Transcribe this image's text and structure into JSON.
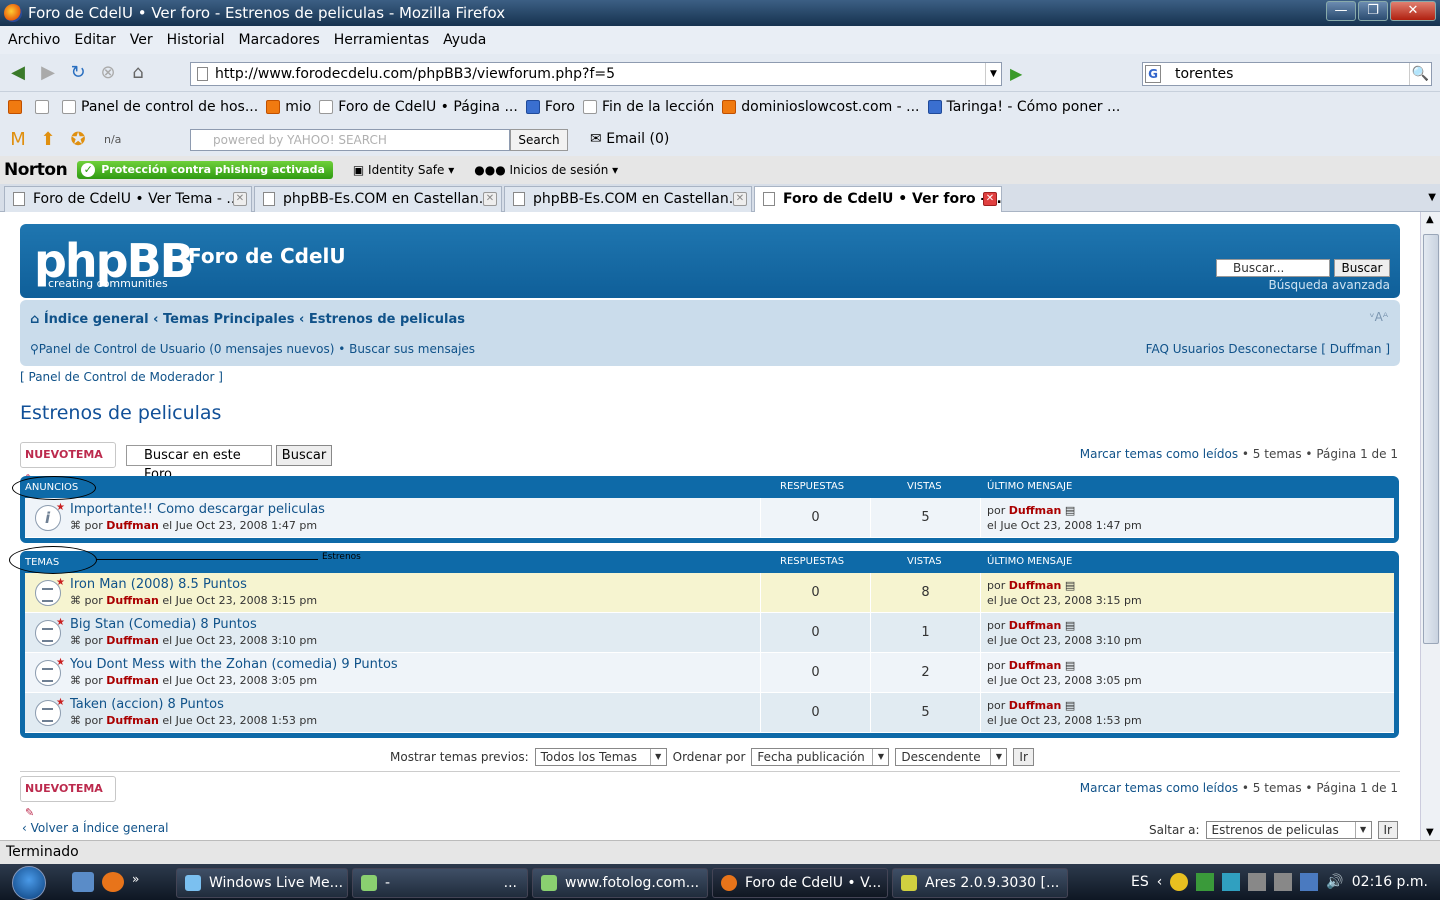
{
  "window": {
    "title": "Foro de CdelU • Ver foro - Estrenos de peliculas - Mozilla Firefox",
    "min": "—",
    "max": "❐",
    "close": "✕"
  },
  "menu": [
    "Archivo",
    "Editar",
    "Ver",
    "Historial",
    "Marcadores",
    "Herramientas",
    "Ayuda"
  ],
  "nav": {
    "url": "http://www.forodecdelu.com/phpBB3/viewforum.php?f=5",
    "search": "torentes",
    "search_engine_icon": "G"
  },
  "bookmarks": [
    "Panel de control de hos...",
    "mio",
    "Foro de CdelU • Página ...",
    "Foro",
    "Fin de la lección",
    "dominioslowcost.com - ...",
    "Taringa! - Cómo poner ..."
  ],
  "yahoo": {
    "powered": "powered by YAHOO! SEARCH",
    "search_btn": "Search",
    "email": "Email (0)",
    "na": "n/a"
  },
  "norton": {
    "logo": "Norton",
    "phishing": "Protección contra phishing activada",
    "identity": "Identity Safe",
    "logins": "Inicios de sesión"
  },
  "tabs": [
    {
      "label": "Foro de CdelU • Ver Tema - ...",
      "active": false
    },
    {
      "label": "phpBB-Es.COM en Castellan...",
      "active": false
    },
    {
      "label": "phpBB-Es.COM en Castellan...",
      "active": false
    },
    {
      "label": "Foro de CdelU • Ver foro - ...",
      "active": true
    }
  ],
  "forum": {
    "logo": "phpBB",
    "logo_sub": "creating    communities",
    "site_name": "Foro de CdelU",
    "search_placeholder": "Buscar...",
    "search_btn": "Buscar",
    "adv_search": "Búsqueda avanzada",
    "crumbs": "Índice general ‹ Temas Principales ‹ Estrenos de peliculas",
    "font_ctl": "ᵛAᴬ",
    "ucp": "Panel de Control de Usuario (0 mensajes nuevos) • Buscar sus mensajes",
    "ucp_right": "FAQ  Usuarios  Desconectarse [ Duffman ]",
    "mcp": "[ Panel de Control de Moderador ]",
    "title": "Estrenos de peliculas",
    "new_topic": "NUEVOTEMA",
    "forum_search_placeholder": "Buscar en este Foro",
    "forum_search_btn": "Buscar",
    "mark_read": "Marcar temas como leídos",
    "page_info": " • 5 temas • Página 1 de 1",
    "col_resp": "RESPUESTAS",
    "col_views": "VISTAS",
    "col_last": "ÚLTIMO MENSAJE",
    "announce_label": "ANUNCIOS",
    "topics_label": "TEMAS",
    "annotation": "Estrenos",
    "announcements": [
      {
        "title": "Importante!! Como descargar peliculas",
        "author": "Duffman",
        "date": "el Jue Oct 23, 2008 1:47 pm",
        "replies": "0",
        "views": "5",
        "last_author": "Duffman",
        "last_date": "el Jue Oct 23, 2008 1:47 pm"
      }
    ],
    "topics": [
      {
        "title": "Iron Man (2008) 8.5 Puntos",
        "author": "Duffman",
        "date": "el Jue Oct 23, 2008 3:15 pm",
        "replies": "0",
        "views": "8",
        "last_author": "Duffman",
        "last_date": "el Jue Oct 23, 2008 3:15 pm"
      },
      {
        "title": "Big Stan (Comedia) 8 Puntos",
        "author": "Duffman",
        "date": "el Jue Oct 23, 2008 3:10 pm",
        "replies": "0",
        "views": "1",
        "last_author": "Duffman",
        "last_date": "el Jue Oct 23, 2008 3:10 pm"
      },
      {
        "title": "You Dont Mess with the Zohan (comedia) 9 Puntos",
        "author": "Duffman",
        "date": "el Jue Oct 23, 2008 3:05 pm",
        "replies": "0",
        "views": "2",
        "last_author": "Duffman",
        "last_date": "el Jue Oct 23, 2008 3:05 pm"
      },
      {
        "title": "Taken (accion) 8 Puntos",
        "author": "Duffman",
        "date": "el Jue Oct 23, 2008 1:53 pm",
        "replies": "0",
        "views": "5",
        "last_author": "Duffman",
        "last_date": "el Jue Oct 23, 2008 1:53 pm"
      }
    ],
    "by": "por",
    "sort_show": "Mostrar temas previos:",
    "sort_show_val": "Todos los Temas",
    "sort_by": "Ordenar por",
    "sort_by_val": "Fecha publicación",
    "sort_dir_val": "Descendente",
    "go": "Ir",
    "back": "Volver a Índice general",
    "jump": "Saltar a:",
    "jump_val": "Estrenos de peliculas"
  },
  "status": "Terminado",
  "taskbar": {
    "items": [
      "Windows Live Me...",
      "-",
      "www.fotolog.com...",
      "Foro de CdelU • V...",
      "Ares 2.0.9.3030   [..."
    ],
    "lang": "ES",
    "time": "02:16 p.m."
  }
}
